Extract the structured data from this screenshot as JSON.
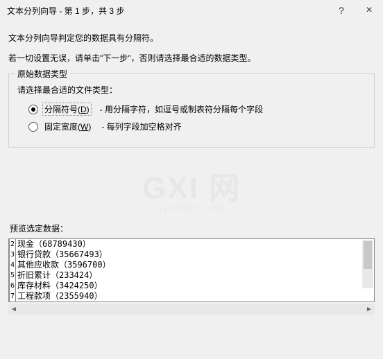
{
  "titlebar": {
    "title": "文本分列向导 - 第 1 步，共 3 步",
    "help": "?",
    "close": "×"
  },
  "intro": {
    "line1": "文本分列向导判定您的数据具有分隔符。",
    "line2": "若一切设置无误，请单击\"下一步\"，否则请选择最合适的数据类型。"
  },
  "fieldset": {
    "legend": "原始数据类型",
    "prompt": "请选择最合适的文件类型：",
    "opt1": {
      "label_pre": "分隔符号(",
      "label_key": "D",
      "label_post": ")",
      "desc": "- 用分隔字符，如逗号或制表符分隔每个字段",
      "selected": true
    },
    "opt2": {
      "label_pre": "固定宽度(",
      "label_key": "W",
      "label_post": ")",
      "desc": "- 每列字段加空格对齐",
      "selected": false
    }
  },
  "watermark": {
    "main": "GXI 网",
    "sub": "system.cnd"
  },
  "preview": {
    "label": "预览选定数据：",
    "rows": [
      {
        "n": "2",
        "text": "现金（68789430）"
      },
      {
        "n": "3",
        "text": "银行贷款（35667493）"
      },
      {
        "n": "4",
        "text": "其他应收款（3596700）"
      },
      {
        "n": "5",
        "text": "折旧累计（233424）"
      },
      {
        "n": "6",
        "text": "库存材料（3424250）"
      },
      {
        "n": "7",
        "text": "工程款项（2355940）"
      }
    ]
  }
}
